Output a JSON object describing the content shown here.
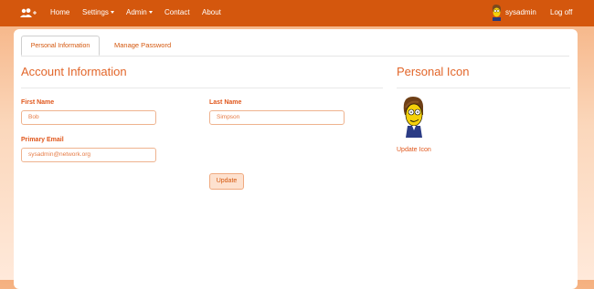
{
  "nav": {
    "home": "Home",
    "settings": "Settings",
    "admin": "Admin",
    "contact": "Contact",
    "about": "About",
    "username": "sysadmin",
    "logoff": "Log off"
  },
  "tabs": {
    "personal": "Personal Information",
    "password": "Manage Password"
  },
  "account": {
    "title": "Account Information",
    "first_name_label": "First Name",
    "first_name_value": "Bob",
    "last_name_label": "Last Name",
    "last_name_value": "Simpson",
    "email_label": "Primary Email",
    "email_value": "sysadmin@network.org",
    "update_button": "Update"
  },
  "personal_icon": {
    "title": "Personal Icon",
    "update_link": "Update Icon"
  },
  "colors": {
    "accent": "#d4570d",
    "heading": "#e2662a"
  }
}
